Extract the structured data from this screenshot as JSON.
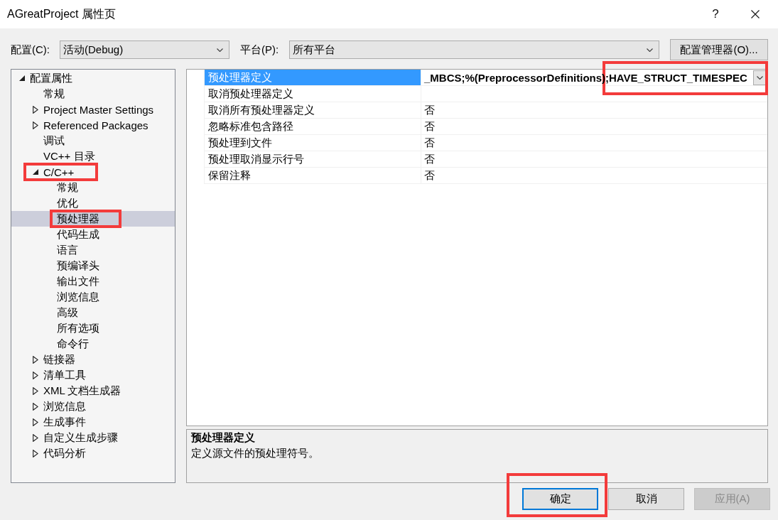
{
  "window": {
    "title": "AGreatProject 属性页",
    "help_button": "?"
  },
  "config_bar": {
    "configuration": {
      "label": "配置(C):",
      "value": "活动(Debug)"
    },
    "platform": {
      "label": "平台(P):",
      "value": "所有平台"
    },
    "manager_button": "配置管理器(O)..."
  },
  "tree": {
    "items": [
      {
        "label": "配置属性",
        "kind": "group",
        "expanded": true,
        "selected": false,
        "annotated": false,
        "children": [
          {
            "label": "常规",
            "kind": "leaf",
            "selected": false,
            "annotated": false
          },
          {
            "label": "Project Master Settings",
            "kind": "group",
            "expanded": false,
            "selected": false,
            "annotated": false
          },
          {
            "label": "Referenced Packages",
            "kind": "group",
            "expanded": false,
            "selected": false,
            "annotated": false
          },
          {
            "label": "调试",
            "kind": "leaf",
            "selected": false,
            "annotated": false
          },
          {
            "label": "VC++ 目录",
            "kind": "leaf",
            "selected": false,
            "annotated": false
          },
          {
            "label": "C/C++",
            "kind": "group",
            "expanded": true,
            "selected": false,
            "annotated": true,
            "children": [
              {
                "label": "常规",
                "kind": "leaf",
                "selected": false,
                "annotated": false
              },
              {
                "label": "优化",
                "kind": "leaf",
                "selected": false,
                "annotated": false
              },
              {
                "label": "预处理器",
                "kind": "leaf",
                "selected": true,
                "annotated": true
              },
              {
                "label": "代码生成",
                "kind": "leaf",
                "selected": false,
                "annotated": false
              },
              {
                "label": "语言",
                "kind": "leaf",
                "selected": false,
                "annotated": false
              },
              {
                "label": "预编译头",
                "kind": "leaf",
                "selected": false,
                "annotated": false
              },
              {
                "label": "输出文件",
                "kind": "leaf",
                "selected": false,
                "annotated": false
              },
              {
                "label": "浏览信息",
                "kind": "leaf",
                "selected": false,
                "annotated": false
              },
              {
                "label": "高级",
                "kind": "leaf",
                "selected": false,
                "annotated": false
              },
              {
                "label": "所有选项",
                "kind": "leaf",
                "selected": false,
                "annotated": false
              },
              {
                "label": "命令行",
                "kind": "leaf",
                "selected": false,
                "annotated": false
              }
            ]
          },
          {
            "label": "链接器",
            "kind": "group",
            "expanded": false,
            "selected": false,
            "annotated": false
          },
          {
            "label": "清单工具",
            "kind": "group",
            "expanded": false,
            "selected": false,
            "annotated": false
          },
          {
            "label": "XML 文档生成器",
            "kind": "group",
            "expanded": false,
            "selected": false,
            "annotated": false
          },
          {
            "label": "浏览信息",
            "kind": "group",
            "expanded": false,
            "selected": false,
            "annotated": false
          },
          {
            "label": "生成事件",
            "kind": "group",
            "expanded": false,
            "selected": false,
            "annotated": false
          },
          {
            "label": "自定义生成步骤",
            "kind": "group",
            "expanded": false,
            "selected": false,
            "annotated": false
          },
          {
            "label": "代码分析",
            "kind": "group",
            "expanded": false,
            "selected": false,
            "annotated": false
          }
        ]
      }
    ]
  },
  "property_grid": {
    "rows": [
      {
        "name": "预处理器定义",
        "value": "_MBCS;%(PreprocessorDefinitions);HAVE_STRUCT_TIMESPEC",
        "modified": true,
        "selected": true,
        "annotated": true
      },
      {
        "name": "取消预处理器定义",
        "selected": false,
        "annotated": false
      },
      {
        "name": "取消所有预处理器定义",
        "value": "否",
        "modified": false,
        "selected": false,
        "annotated": false
      },
      {
        "name": "忽略标准包含路径",
        "value": "否",
        "modified": false,
        "selected": false,
        "annotated": false
      },
      {
        "name": "预处理到文件",
        "value": "否",
        "modified": false,
        "selected": false,
        "annotated": false
      },
      {
        "name": "预处理取消显示行号",
        "value": "否",
        "modified": false,
        "selected": false,
        "annotated": false
      },
      {
        "name": "保留注释",
        "value": "否",
        "modified": false,
        "selected": false,
        "annotated": false
      }
    ]
  },
  "description": {
    "title": "预处理器定义",
    "text": "定义源文件的预处理符号。"
  },
  "buttons": [
    {
      "label": "确定",
      "default": true,
      "disabled": false,
      "annotated": true
    },
    {
      "label": "取消",
      "default": false,
      "disabled": false,
      "annotated": false
    },
    {
      "label": "应用(A)",
      "default": false,
      "disabled": true,
      "annotated": false
    }
  ]
}
